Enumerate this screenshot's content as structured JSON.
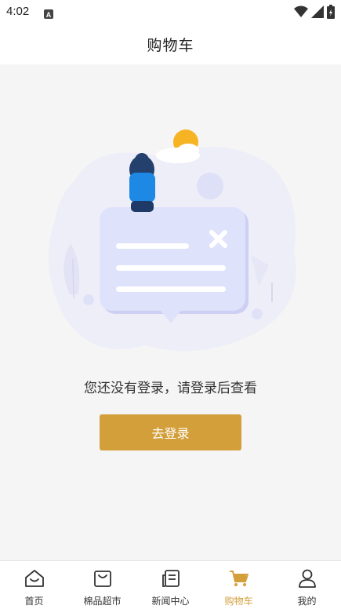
{
  "status_bar": {
    "time": "4:02",
    "notification_icon": "a-letter-icon",
    "icons": [
      "wifi-icon",
      "signal-icon",
      "battery-icon"
    ]
  },
  "header": {
    "title": "购物车"
  },
  "empty_state": {
    "illustration": "empty-cart-illustration",
    "message": "您还没有登录，请登录后查看",
    "button_label": "去登录"
  },
  "tabbar": {
    "active_color": "#d39f3b",
    "items": [
      {
        "label": "首页",
        "icon": "home-icon",
        "active": false
      },
      {
        "label": "棉品超市",
        "icon": "shopping-bag-icon",
        "active": false
      },
      {
        "label": "新闻中心",
        "icon": "news-icon",
        "active": false
      },
      {
        "label": "购物车",
        "icon": "cart-icon",
        "active": true
      },
      {
        "label": "我的",
        "icon": "user-icon",
        "active": false
      }
    ]
  },
  "colors": {
    "accent": "#d39f3b",
    "background": "#f5f5f5"
  }
}
